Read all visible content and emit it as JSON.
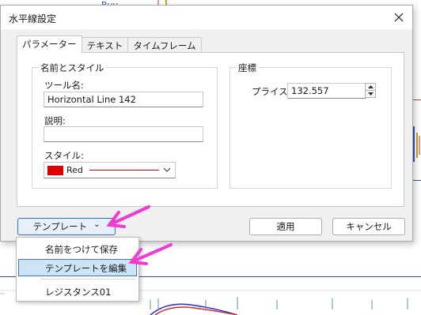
{
  "dialog": {
    "title": "水平線設定"
  },
  "tabs": [
    {
      "label": "パラメーター"
    },
    {
      "label": "テキスト"
    },
    {
      "label": "タイムフレーム"
    }
  ],
  "name_style_group": {
    "title": "名前とスタイル",
    "tool_name_label": "ツール名:",
    "tool_name_value": "Horizontal Line 142",
    "description_label": "説明:",
    "description_value": "",
    "style_label": "スタイル:",
    "style_color_name": "Red",
    "style_color": "#e00000"
  },
  "coordinates_group": {
    "title": "座標",
    "price_label": "プライス:",
    "price_value": "132.557"
  },
  "buttons": {
    "template": "テンプレート",
    "template_chevron": "⌄",
    "apply": "適用",
    "cancel": "キャンセル"
  },
  "template_menu": {
    "items": [
      {
        "label": "名前をつけて保存"
      },
      {
        "label": "テンプレートを編集"
      },
      {
        "label": "レジスタンス01"
      }
    ]
  },
  "background": {
    "buy_label": "Buy"
  },
  "colors": {
    "annotation_arrow": "#f03cd2",
    "accent_border": "#2f6fd6",
    "menu_highlight": "#cde4f7"
  }
}
